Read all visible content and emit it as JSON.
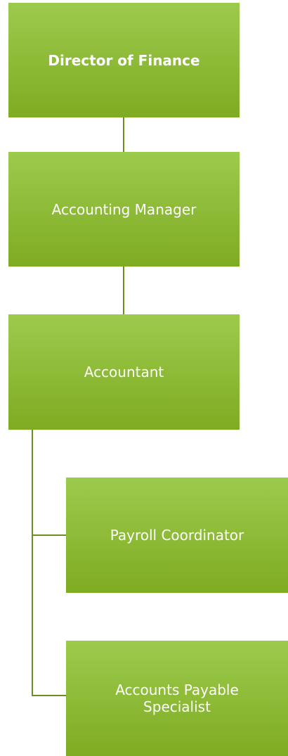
{
  "org_chart": {
    "nodes": [
      {
        "label": "Director of Finance"
      },
      {
        "label": "Accounting Manager"
      },
      {
        "label": "Accountant"
      },
      {
        "label": "Payroll Coordinator"
      },
      {
        "label": "Accounts Payable Specialist"
      }
    ],
    "colors": {
      "box_fill_top": "#9cca4c",
      "box_fill_bottom": "#7fab22",
      "connector": "#6a8f1e",
      "text": "#ffffff"
    }
  }
}
